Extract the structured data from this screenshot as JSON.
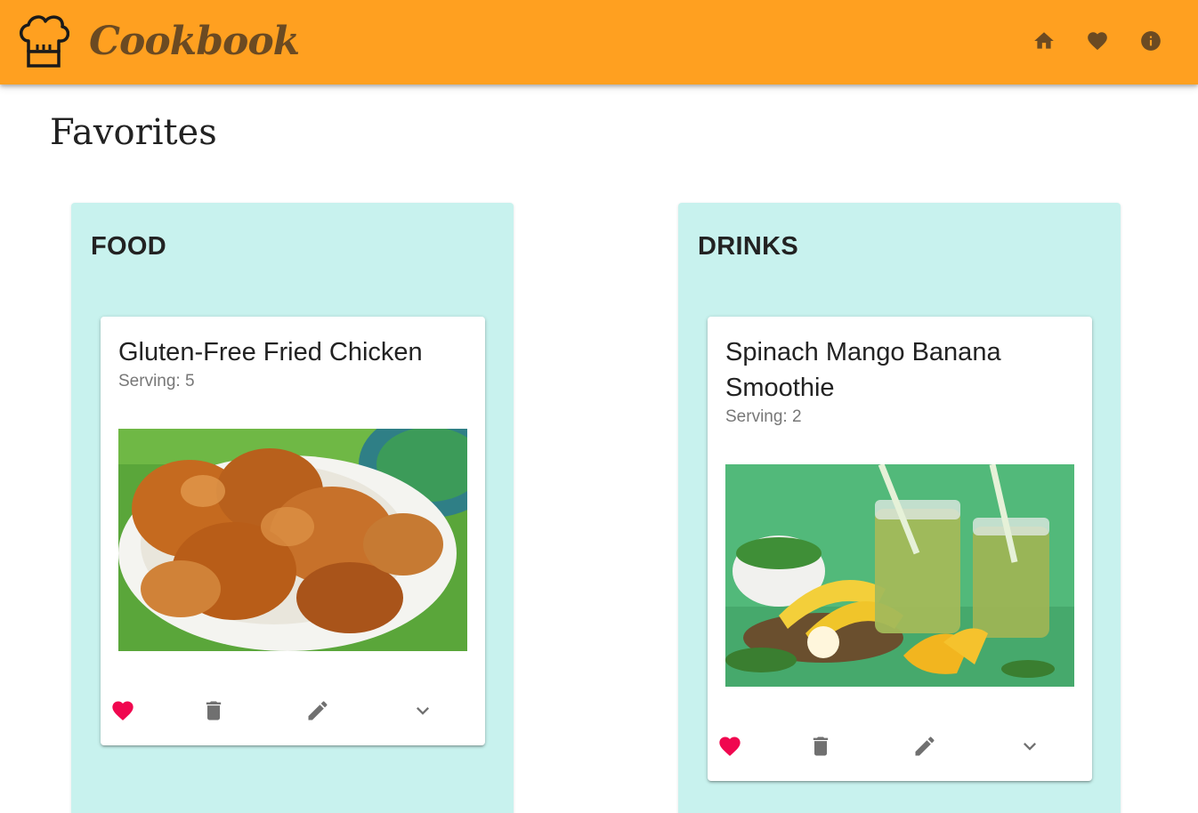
{
  "app": {
    "name": "Cookbook",
    "logo_icon": "chef-hat-icon",
    "accent_color": "#ffa020",
    "text_brown": "#6b4a22"
  },
  "nav": [
    {
      "icon": "home-icon"
    },
    {
      "icon": "heart-icon"
    },
    {
      "icon": "info-icon"
    }
  ],
  "page": {
    "title": "Favorites"
  },
  "panel_color": "#c8f2ee",
  "categories": [
    {
      "title": "FOOD",
      "recipes": [
        {
          "title": "Gluten-Free Fried Chicken",
          "serving": "Serving: 5",
          "image": "fried-chicken-photo",
          "favorite": true,
          "actions": [
            "heart-icon",
            "delete-icon",
            "edit-icon",
            "chevron-down-icon"
          ]
        }
      ]
    },
    {
      "title": "DRINKS",
      "recipes": [
        {
          "title": "Spinach Mango Banana Smoothie",
          "serving": "Serving: 2",
          "image": "smoothie-photo",
          "favorite": true,
          "actions": [
            "heart-icon",
            "delete-icon",
            "edit-icon",
            "chevron-down-icon"
          ]
        }
      ]
    }
  ]
}
